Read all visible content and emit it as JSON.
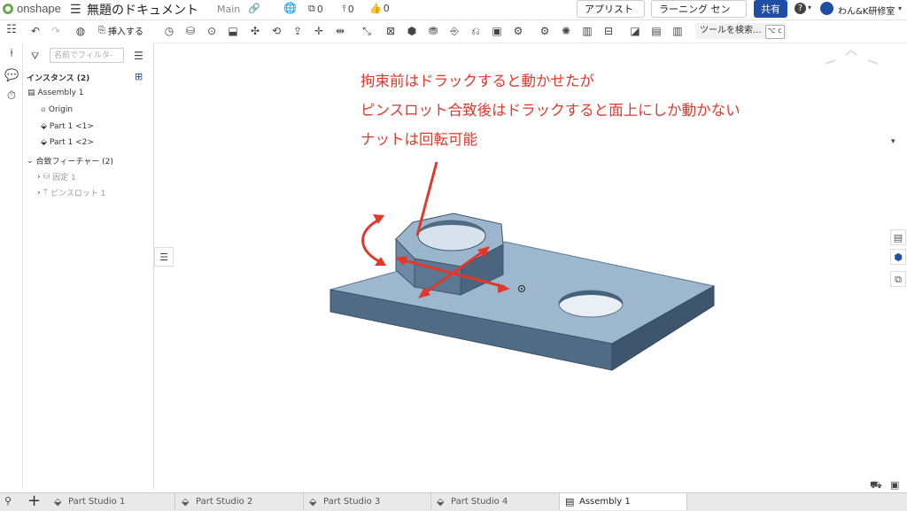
{
  "header": {
    "logo_text": "onshape",
    "doc_title": "無題のドキュメント",
    "branch": "Main",
    "count_versions": "0",
    "count_branches": "0",
    "count_likes": "0",
    "appstore_label": "アプリストア",
    "learning_label": "ラーニング センター",
    "share_label": "共有",
    "help_label": "?",
    "user_name": "わん&K研修室"
  },
  "toolbar": {
    "insert_label": "挿入する",
    "tool_search_label": "ツールを検索...",
    "shortcut_label": "⌥ c"
  },
  "panel": {
    "filter_placeholder": "名前でフィルタ-",
    "instances_header": "インスタンス (2)",
    "assembly": "Assembly 1",
    "origin": "Origin",
    "part1": "Part 1 <1>",
    "part2": "Part 1 <2>",
    "mate_header": "合致フィーチャー (2)",
    "mate1": "固定 1",
    "mate2": "ピンスロット 1"
  },
  "annotation": {
    "line1": "拘束前はドラックすると動かせたが",
    "line2": "ピンスロット合致後はドラックすると面上にしか動かない",
    "line3": "ナットは回転可能",
    "color": "#e0392b"
  },
  "tabs": [
    {
      "label": "Part Studio 1"
    },
    {
      "label": "Part Studio 2"
    },
    {
      "label": "Part Studio 3"
    },
    {
      "label": "Part Studio 4"
    },
    {
      "label": "Assembly 1"
    }
  ],
  "colors": {
    "part_top": "#9db7cf",
    "part_front": "#4f6b85",
    "part_side": "#3d566d",
    "accent": "#1f4ea6"
  }
}
